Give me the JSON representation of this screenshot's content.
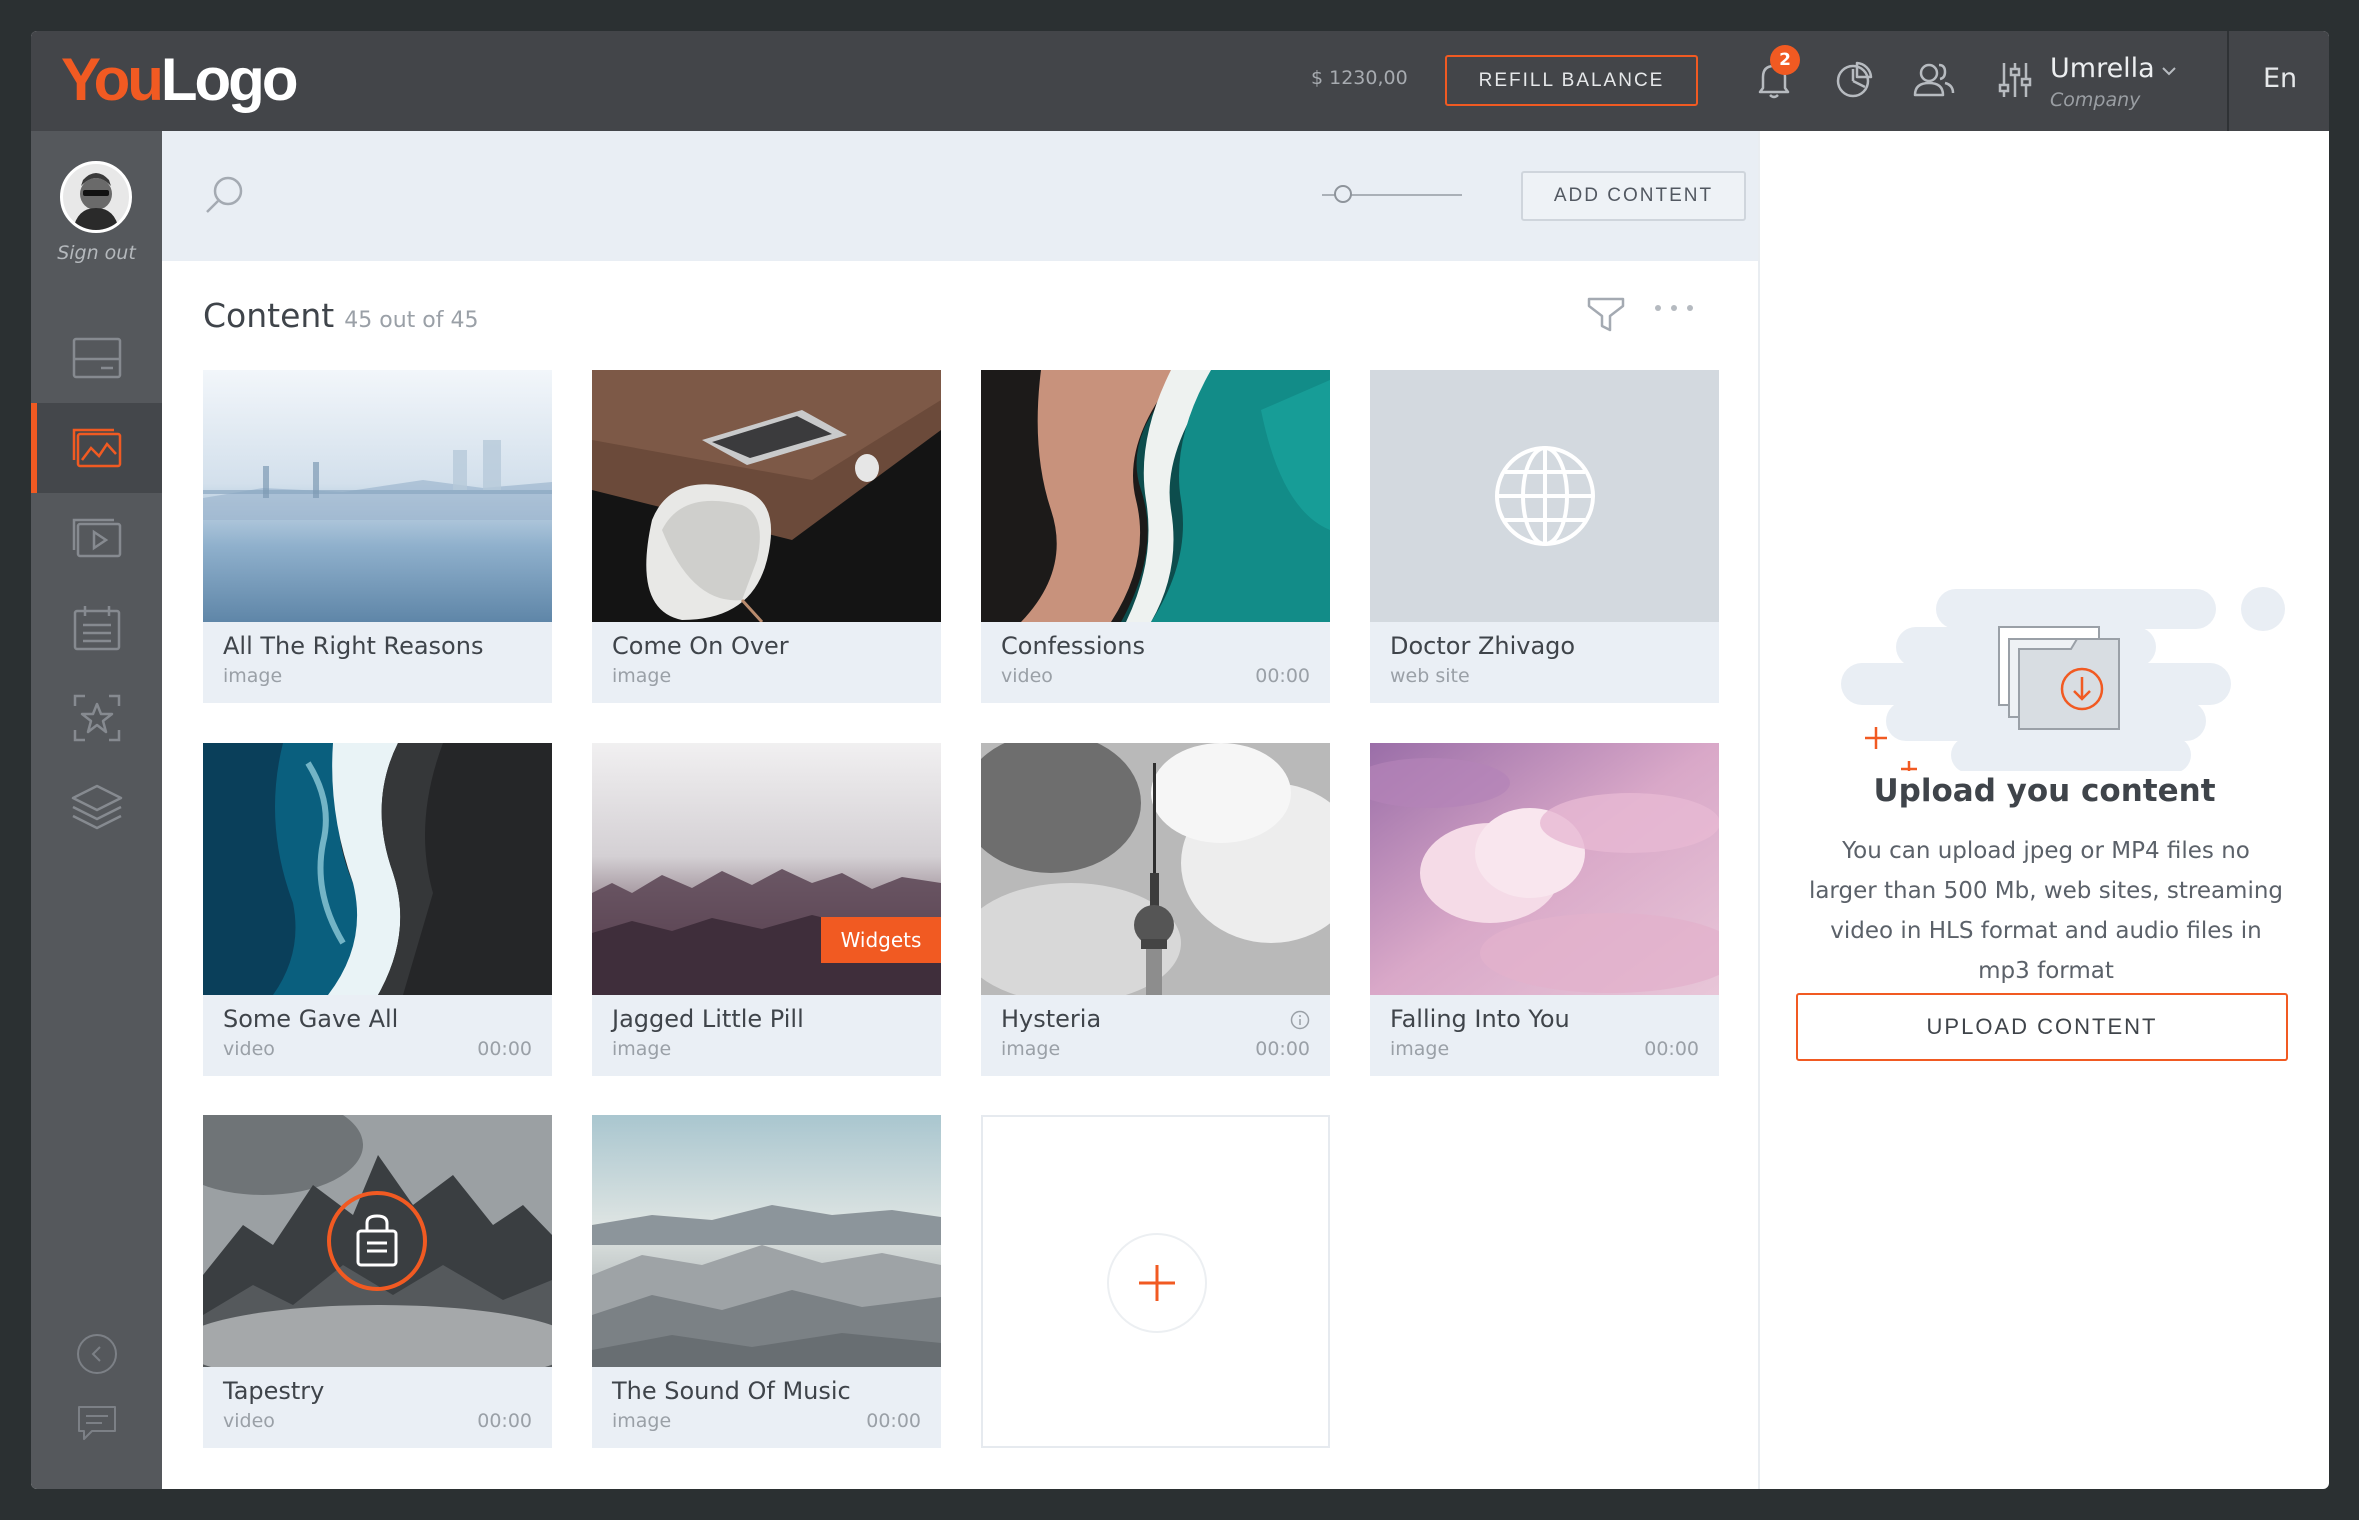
{
  "header": {
    "logo_you": "You",
    "logo_rest": "Logo",
    "balance": "$ 1230,00",
    "refill_label": "REFILL BALANCE",
    "notifications_count": "2",
    "user_name": "Umrella",
    "user_company": "Company",
    "language": "En"
  },
  "sidebar": {
    "sign_out": "Sign out",
    "items": [
      {
        "icon": "monitor-icon",
        "active": false
      },
      {
        "icon": "image-gallery-icon",
        "active": true
      },
      {
        "icon": "video-play-icon",
        "active": false
      },
      {
        "icon": "calendar-icon",
        "active": false
      },
      {
        "icon": "star-frame-icon",
        "active": false
      },
      {
        "icon": "layers-icon",
        "active": false
      }
    ],
    "bottom": [
      "collapse-icon",
      "chat-icon"
    ]
  },
  "toolbar": {
    "search_icon": "search-icon",
    "add_content_label": "ADD CONTENT"
  },
  "content": {
    "title": "Content",
    "count": "45 out of 45",
    "cards": [
      {
        "title": "All The Right Reasons",
        "type": "image",
        "duration": ""
      },
      {
        "title": "Come On Over",
        "type": "image",
        "duration": ""
      },
      {
        "title": "Confessions",
        "type": "video",
        "duration": "00:00"
      },
      {
        "title": "Doctor Zhivago",
        "type": "web site",
        "duration": ""
      },
      {
        "title": "Some Gave All",
        "type": "video",
        "duration": "00:00"
      },
      {
        "title": "Jagged Little Pill",
        "type": "image",
        "duration": "",
        "badge": "Widgets"
      },
      {
        "title": "Hysteria",
        "type": "image",
        "duration": "00:00"
      },
      {
        "title": "Falling Into You",
        "type": "image",
        "duration": "00:00"
      },
      {
        "title": "Tapestry",
        "type": "video",
        "duration": "00:00"
      },
      {
        "title": "The Sound Of Music",
        "type": "image",
        "duration": "00:00"
      }
    ]
  },
  "upload_panel": {
    "title": "Upload you content",
    "description": "You can upload jpeg or MP4 files no larger than 500 Mb, web sites, streaming video in HLS format and audio files in mp3 format",
    "button_label": "UPLOAD CONTENT"
  },
  "colors": {
    "accent": "#f15a22",
    "topbar": "#434549",
    "sidebar": "#55585c",
    "card_bg": "#eaeff5"
  }
}
